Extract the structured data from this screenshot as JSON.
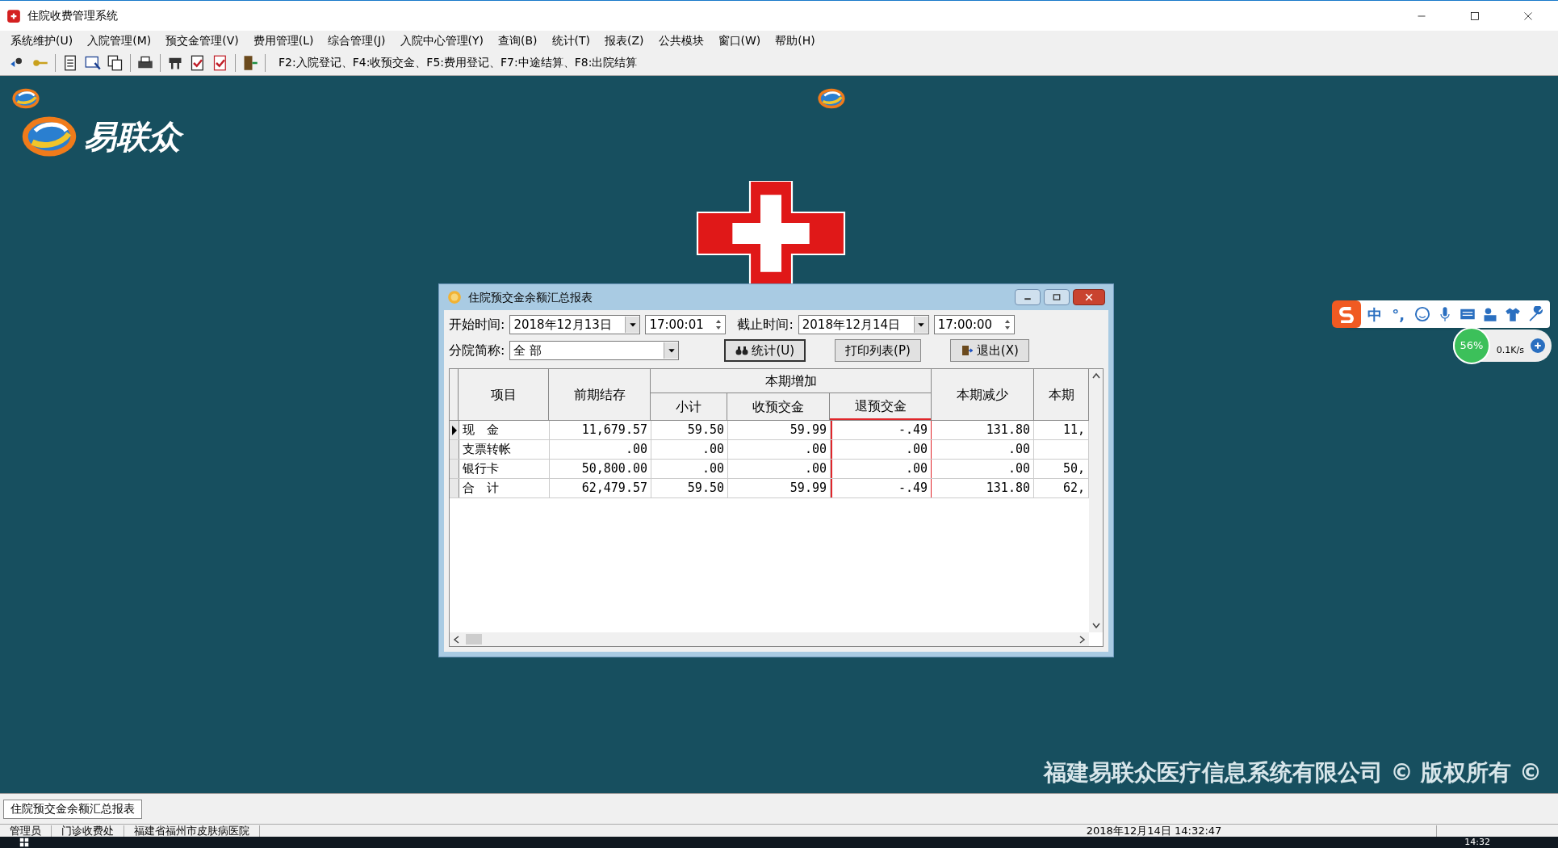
{
  "window": {
    "title": "住院收费管理系统"
  },
  "menu": [
    "系统维护(U)",
    "入院管理(M)",
    "预交金管理(V)",
    "费用管理(L)",
    "综合管理(J)",
    "入院中心管理(Y)",
    "查询(B)",
    "统计(T)",
    "报表(Z)",
    "公共模块",
    "窗口(W)",
    "帮助(H)"
  ],
  "toolbar": {
    "hint": "F2:入院登记、F4:收预交金、F5:费用登记、F7:中途结算、F8:出院结算"
  },
  "desktop": {
    "logo_text": "易联众",
    "copyright": "福建易联众医疗信息系统有限公司 © 版权所有 ©"
  },
  "dialog": {
    "title": "住院预交金余额汇总报表",
    "start_label": "开始时间:",
    "start_date": "2018年12月13日",
    "start_time": "17:00:01",
    "end_label": "截止时间:",
    "end_date": "2018年12月14日",
    "end_time": "17:00:00",
    "branch_label": "分院简称:",
    "branch_value": "全 部",
    "buttons": [
      {
        "label": "统计(U)",
        "kind": "stat"
      },
      {
        "label": "打印列表(P)",
        "kind": "print"
      },
      {
        "label": "退出(X)",
        "kind": "exit"
      }
    ],
    "table": {
      "columns": [
        {
          "label": "项目",
          "highlighted": false
        },
        {
          "label": "前期结存",
          "highlighted": false
        },
        {
          "label": "本期增加",
          "highlighted": false,
          "children": [
            {
              "label": "小计",
              "highlighted": false
            },
            {
              "label": "收预交金",
              "highlighted": false
            },
            {
              "label": "退预交金",
              "highlighted": true
            }
          ]
        },
        {
          "label": "本期减少",
          "highlighted": false
        },
        {
          "label": "本期",
          "highlighted": false
        }
      ],
      "rows": [
        {
          "selected": true,
          "cells": [
            "现　金",
            "11,679.57",
            "59.50",
            "59.99",
            "-.49",
            "131.80",
            "11,"
          ]
        },
        {
          "selected": false,
          "cells": [
            "支票转帐",
            ".00",
            ".00",
            ".00",
            ".00",
            ".00",
            ""
          ]
        },
        {
          "selected": false,
          "cells": [
            "银行卡",
            "50,800.00",
            ".00",
            ".00",
            ".00",
            ".00",
            "50,"
          ]
        },
        {
          "selected": false,
          "cells": [
            "合　计",
            "62,479.57",
            "59.50",
            "59.99",
            "-.49",
            "131.80",
            "62,"
          ]
        }
      ]
    }
  },
  "ime": {
    "mode": "中",
    "punct": "°,",
    "meter": "56%",
    "speed": "0.1K/s"
  },
  "bottom_tab": "住院预交金余额汇总报表",
  "status_bar": [
    "管理员",
    "门诊收费处",
    "福建省福州市皮肤病医院",
    "2018年12月14日 14:32:47"
  ],
  "taskbar": {
    "time": "14:32"
  }
}
